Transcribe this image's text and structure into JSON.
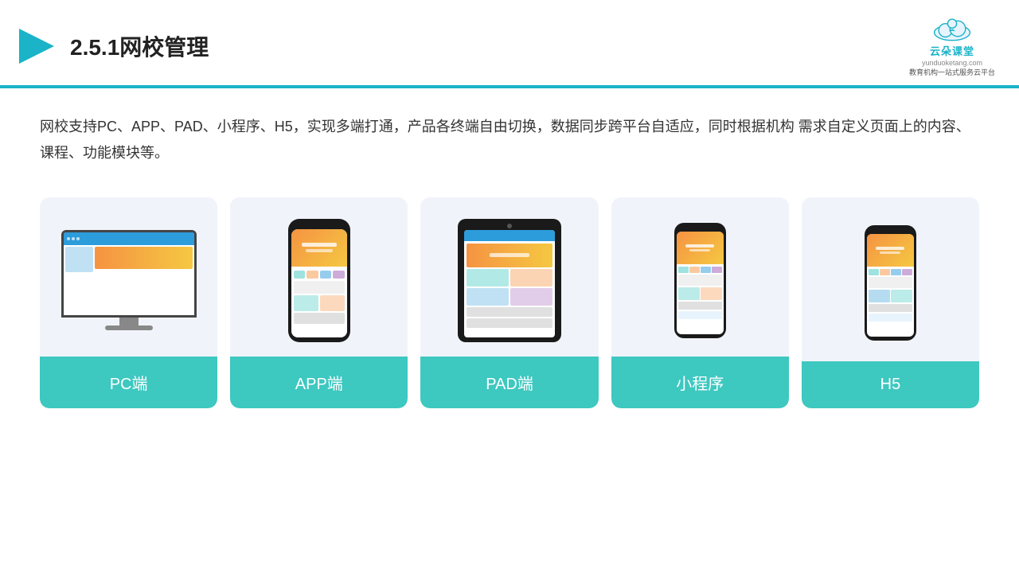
{
  "header": {
    "title": "2.5.1网校管理",
    "logo_name": "云朵课堂",
    "logo_sub": "教育机构一站\n式服务云平台",
    "logo_url": "yunduoketang.com"
  },
  "description": {
    "text": "网校支持PC、APP、PAD、小程序、H5，实现多端打通，产品各终端自由切换，数据同步跨平台自适应，同时根据机构\n需求自定义页面上的内容、课程、功能模块等。"
  },
  "cards": [
    {
      "id": "pc",
      "label": "PC端"
    },
    {
      "id": "app",
      "label": "APP端"
    },
    {
      "id": "pad",
      "label": "PAD端"
    },
    {
      "id": "mini",
      "label": "小程序"
    },
    {
      "id": "h5",
      "label": "H5"
    }
  ],
  "colors": {
    "accent": "#1ab3c8",
    "card_bg": "#f0f4fa",
    "label_bg": "#3dc8c0",
    "label_text": "#ffffff"
  }
}
